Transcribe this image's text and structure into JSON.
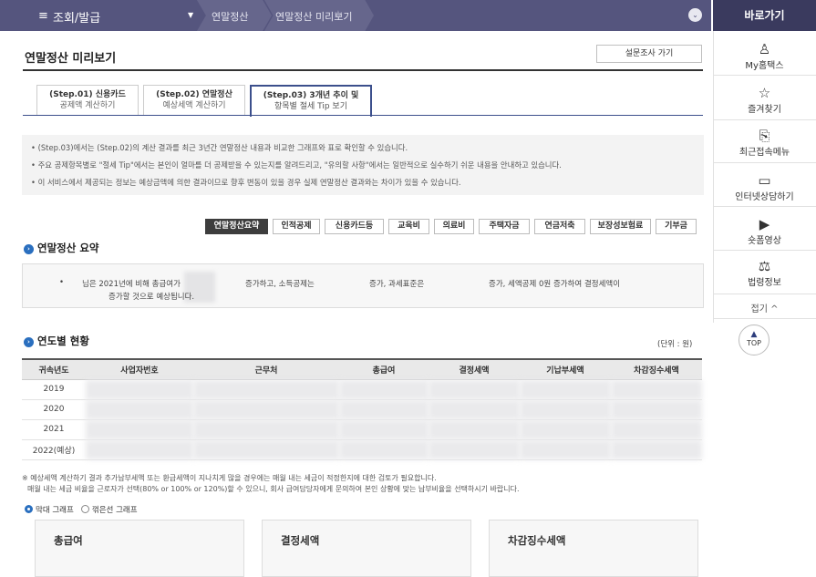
{
  "topbar": {
    "menu_icon": "≡",
    "menu_label": "조회/발급",
    "dropdown_icon": "▼",
    "crumb1": "연말정산",
    "crumb2": "연말정산 미리보기",
    "star_icon": "★",
    "circle_icon": "⌄"
  },
  "quickbar": {
    "title": "바로가기",
    "items": [
      {
        "icon": "person-icon",
        "glyph": "♙",
        "label": "My홈택스"
      },
      {
        "icon": "star-icon",
        "glyph": "☆",
        "label": "즐겨찾기"
      },
      {
        "icon": "recent-menu-icon",
        "glyph": "⎘",
        "label": "최근접속메뉴"
      },
      {
        "icon": "monitor-icon",
        "glyph": "▭",
        "label": "인터넷상담하기"
      },
      {
        "icon": "play-icon",
        "glyph": "▶",
        "label": "숏폼영상"
      },
      {
        "icon": "gavel-icon",
        "glyph": "⚖",
        "label": "법령정보"
      }
    ],
    "fold_label": "접기 ^",
    "top_label": "TOP",
    "top_icon": "▲"
  },
  "page": {
    "title": "연말정산 미리보기",
    "survey_button": "설문조사 가기"
  },
  "steps": [
    {
      "line1": "(Step.01) 신용카드",
      "line2": "공제액 계산하기"
    },
    {
      "line1": "(Step.02) 연말정산",
      "line2": "예상세액 계산하기"
    },
    {
      "line1": "(Step.03) 3개년 추이 및",
      "line2": "항목별 절세 Tip 보기"
    }
  ],
  "notes": [
    "• (Step.03)에서는 (Step.02)의 계산 결과를 최근 3년간 연말정산 내용과 비교한 그래프와 표로 확인할 수 있습니다.",
    "• 주요 공제항목별로 \"절세 Tip\"에서는 본인이 얼마를 더 공제받을 수 있는지를 알려드리고, \"유의할 사항\"에서는 일반적으로 실수하기 쉬운 내용을 안내하고 있습니다.",
    "• 이 서비스에서 제공되는 정보는 예상금액에 의한 결과이므로 향후 변동이 있을 경우 실제 연말정산 결과와는 차이가 있을 수 있습니다."
  ],
  "tabs": [
    "연말정산요약",
    "인적공제",
    "신용카드등",
    "교육비",
    "의료비",
    "주택자금",
    "연금저축",
    "보장성보험료",
    "기부금"
  ],
  "summary": {
    "heading": "연말정산 요약",
    "bullet": "•",
    "t1": "님은 2021년에 비해 총급여가",
    "t2": "증가하고, 소득공제는",
    "t3": "증가, 과세표준은",
    "t4": "증가, 세액공제 0원 증가하여 결정세액이",
    "t5": "증가할 것으로 예상됩니다."
  },
  "yearly": {
    "heading": "연도별 현황",
    "unit": "(단위 : 원)",
    "columns": [
      "귀속년도",
      "사업자번호",
      "근무처",
      "총급여",
      "결정세액",
      "기납부세액",
      "차감징수세액"
    ],
    "years": [
      "2019",
      "2020",
      "2021",
      "2022(예상)"
    ]
  },
  "footnote": {
    "line1": "※ 예상세액 계산하기 결과 추가납부세액 또는 환급세액이 지나치게 많을 경우에는 매월 내는 세금이 적정한지에 대한 검토가 필요합니다.",
    "line2": "매월 내는 세금 비율을 근로자가 선택(80% or 100% or 120%)할 수 있으니, 회사 급여담당자에게 문의하여 본인 상황에 맞는 납부비율을 선택하시기 바랍니다."
  },
  "graph_options": {
    "bar": "막대 그래프",
    "line": "꺾은선 그래프"
  },
  "graph_boxes": [
    "총급여",
    "결정세액",
    "차감징수세액"
  ]
}
